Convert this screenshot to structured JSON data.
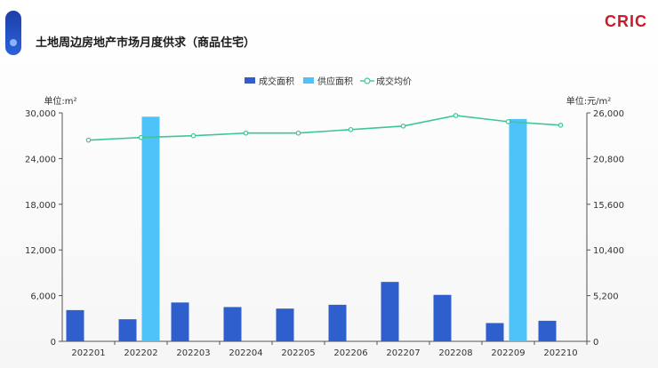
{
  "header": {
    "title": "土地周边房地产市场月度供求（商品住宅）",
    "brand": "CRIC"
  },
  "chart_data": {
    "type": "bar",
    "categories": [
      "202201",
      "202202",
      "202203",
      "202204",
      "202205",
      "202206",
      "202207",
      "202208",
      "202209",
      "202210"
    ],
    "series": [
      {
        "name": "成交面积",
        "type": "bar",
        "axis": "left",
        "color": "#2f5fcd",
        "values": [
          4100,
          2900,
          5100,
          4500,
          4300,
          4800,
          7800,
          6100,
          2400,
          2700
        ]
      },
      {
        "name": "供应面积",
        "type": "bar",
        "axis": "left",
        "color": "#4dc3fa",
        "values": [
          null,
          29500,
          null,
          null,
          null,
          null,
          null,
          null,
          29200,
          null
        ]
      },
      {
        "name": "成交均价",
        "type": "line",
        "axis": "right",
        "color": "#3dc795",
        "values": [
          22900,
          23200,
          23400,
          23700,
          23700,
          24100,
          24500,
          25700,
          25000,
          24600
        ]
      }
    ],
    "y_left": {
      "label": "单位:m²",
      "min": 0,
      "max": 30000,
      "ticks": [
        "0",
        "6,000",
        "12,000",
        "18,000",
        "24,000",
        "30,000"
      ]
    },
    "y_right": {
      "label": "单位:元/m²",
      "min": 0,
      "max": 26000,
      "ticks": [
        "0",
        "5,200",
        "10,400",
        "15,600",
        "20,800",
        "26,000"
      ]
    },
    "legend_position": "top-center",
    "grid": false
  }
}
